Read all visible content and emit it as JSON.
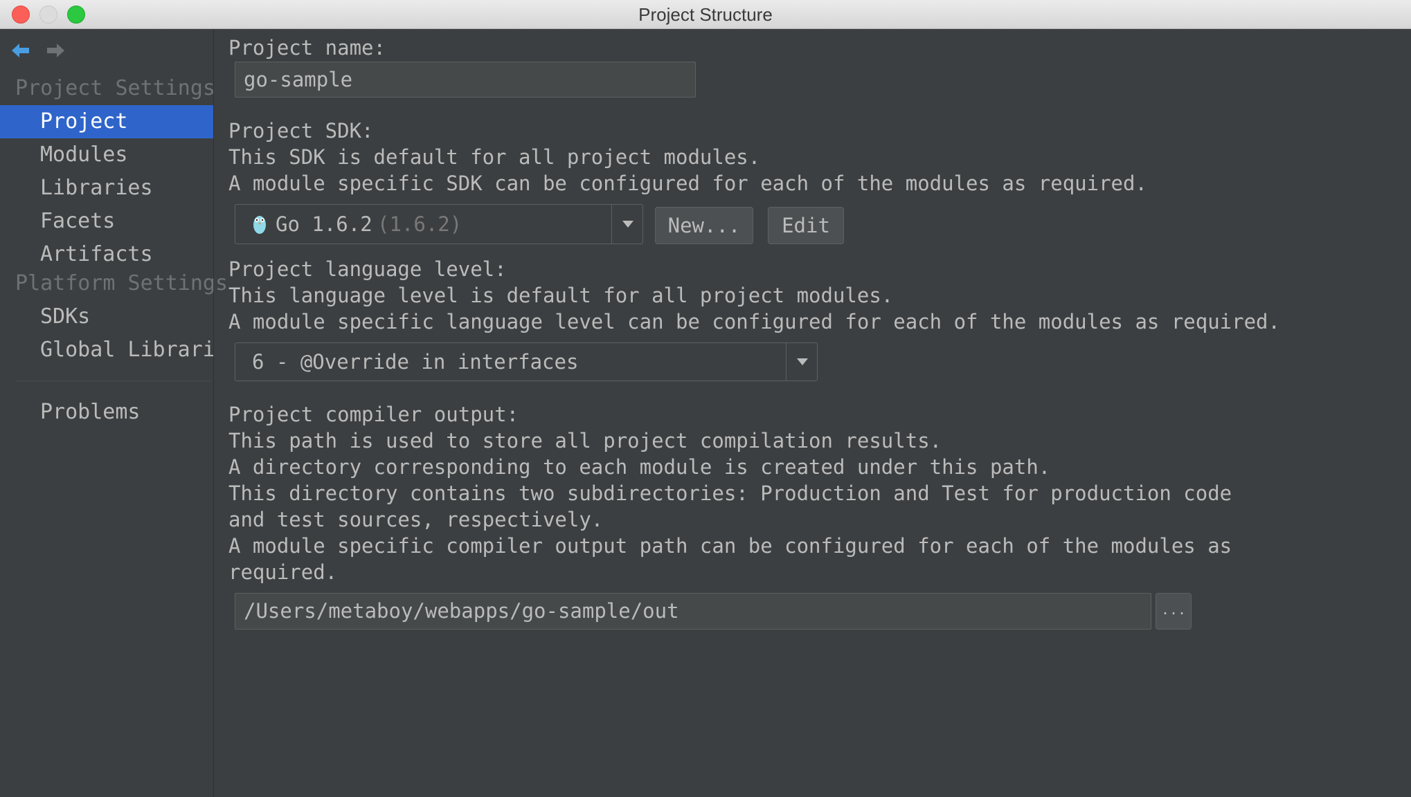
{
  "window": {
    "title": "Project Structure"
  },
  "sidebar": {
    "project_settings_header": "Project Settings",
    "platform_settings_header": "Platform Settings",
    "items": [
      {
        "label": "Project"
      },
      {
        "label": "Modules"
      },
      {
        "label": "Libraries"
      },
      {
        "label": "Facets"
      },
      {
        "label": "Artifacts"
      },
      {
        "label": "SDKs"
      },
      {
        "label": "Global Libraries"
      },
      {
        "label": "Problems"
      }
    ],
    "selected": "Project"
  },
  "main": {
    "project_name": {
      "label": "Project name:",
      "value": "go-sample"
    },
    "sdk": {
      "label": "Project SDK:",
      "desc1": "This SDK is default for all project modules.",
      "desc2": "A module specific SDK can be configured for each of the modules as required.",
      "selected_name": "Go 1.6.2",
      "selected_version": "(1.6.2)",
      "icon": "gopher-icon",
      "new_button": "New...",
      "edit_button": "Edit"
    },
    "language_level": {
      "label": "Project language level:",
      "desc1": "This language level is default for all project modules.",
      "desc2": "A module specific language level can be configured for each of the modules as required.",
      "selected": "6 - @Override in interfaces"
    },
    "compiler_output": {
      "label": "Project compiler output:",
      "desc1": "This path is used to store all project compilation results.",
      "desc2": "A directory corresponding to each module is created under this path.",
      "desc3": "This directory contains two subdirectories: Production and Test for production code",
      "desc4": "and test sources, respectively.",
      "desc5": "A module specific compiler output path can be configured for each of the modules as",
      "desc6": "required.",
      "path": "/Users/metaboy/webapps/go-sample/out",
      "browse_button": "..."
    }
  },
  "colors": {
    "background": "#3c3f41",
    "selection": "#2f65ca",
    "text": "#bbbbbb",
    "nav_arrow_active": "#4a9de0"
  }
}
